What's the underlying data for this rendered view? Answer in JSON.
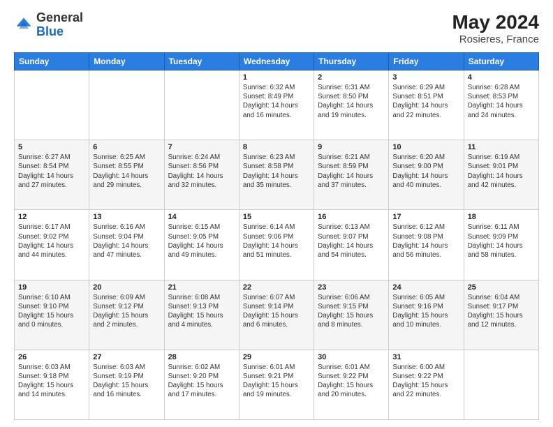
{
  "header": {
    "logo_general": "General",
    "logo_blue": "Blue",
    "month_year": "May 2024",
    "location": "Rosieres, France"
  },
  "weekdays": [
    "Sunday",
    "Monday",
    "Tuesday",
    "Wednesday",
    "Thursday",
    "Friday",
    "Saturday"
  ],
  "weeks": [
    [
      {
        "day": "",
        "info": ""
      },
      {
        "day": "",
        "info": ""
      },
      {
        "day": "",
        "info": ""
      },
      {
        "day": "1",
        "info": "Sunrise: 6:32 AM\nSunset: 8:49 PM\nDaylight: 14 hours\nand 16 minutes."
      },
      {
        "day": "2",
        "info": "Sunrise: 6:31 AM\nSunset: 8:50 PM\nDaylight: 14 hours\nand 19 minutes."
      },
      {
        "day": "3",
        "info": "Sunrise: 6:29 AM\nSunset: 8:51 PM\nDaylight: 14 hours\nand 22 minutes."
      },
      {
        "day": "4",
        "info": "Sunrise: 6:28 AM\nSunset: 8:53 PM\nDaylight: 14 hours\nand 24 minutes."
      }
    ],
    [
      {
        "day": "5",
        "info": "Sunrise: 6:27 AM\nSunset: 8:54 PM\nDaylight: 14 hours\nand 27 minutes."
      },
      {
        "day": "6",
        "info": "Sunrise: 6:25 AM\nSunset: 8:55 PM\nDaylight: 14 hours\nand 29 minutes."
      },
      {
        "day": "7",
        "info": "Sunrise: 6:24 AM\nSunset: 8:56 PM\nDaylight: 14 hours\nand 32 minutes."
      },
      {
        "day": "8",
        "info": "Sunrise: 6:23 AM\nSunset: 8:58 PM\nDaylight: 14 hours\nand 35 minutes."
      },
      {
        "day": "9",
        "info": "Sunrise: 6:21 AM\nSunset: 8:59 PM\nDaylight: 14 hours\nand 37 minutes."
      },
      {
        "day": "10",
        "info": "Sunrise: 6:20 AM\nSunset: 9:00 PM\nDaylight: 14 hours\nand 40 minutes."
      },
      {
        "day": "11",
        "info": "Sunrise: 6:19 AM\nSunset: 9:01 PM\nDaylight: 14 hours\nand 42 minutes."
      }
    ],
    [
      {
        "day": "12",
        "info": "Sunrise: 6:17 AM\nSunset: 9:02 PM\nDaylight: 14 hours\nand 44 minutes."
      },
      {
        "day": "13",
        "info": "Sunrise: 6:16 AM\nSunset: 9:04 PM\nDaylight: 14 hours\nand 47 minutes."
      },
      {
        "day": "14",
        "info": "Sunrise: 6:15 AM\nSunset: 9:05 PM\nDaylight: 14 hours\nand 49 minutes."
      },
      {
        "day": "15",
        "info": "Sunrise: 6:14 AM\nSunset: 9:06 PM\nDaylight: 14 hours\nand 51 minutes."
      },
      {
        "day": "16",
        "info": "Sunrise: 6:13 AM\nSunset: 9:07 PM\nDaylight: 14 hours\nand 54 minutes."
      },
      {
        "day": "17",
        "info": "Sunrise: 6:12 AM\nSunset: 9:08 PM\nDaylight: 14 hours\nand 56 minutes."
      },
      {
        "day": "18",
        "info": "Sunrise: 6:11 AM\nSunset: 9:09 PM\nDaylight: 14 hours\nand 58 minutes."
      }
    ],
    [
      {
        "day": "19",
        "info": "Sunrise: 6:10 AM\nSunset: 9:10 PM\nDaylight: 15 hours\nand 0 minutes."
      },
      {
        "day": "20",
        "info": "Sunrise: 6:09 AM\nSunset: 9:12 PM\nDaylight: 15 hours\nand 2 minutes."
      },
      {
        "day": "21",
        "info": "Sunrise: 6:08 AM\nSunset: 9:13 PM\nDaylight: 15 hours\nand 4 minutes."
      },
      {
        "day": "22",
        "info": "Sunrise: 6:07 AM\nSunset: 9:14 PM\nDaylight: 15 hours\nand 6 minutes."
      },
      {
        "day": "23",
        "info": "Sunrise: 6:06 AM\nSunset: 9:15 PM\nDaylight: 15 hours\nand 8 minutes."
      },
      {
        "day": "24",
        "info": "Sunrise: 6:05 AM\nSunset: 9:16 PM\nDaylight: 15 hours\nand 10 minutes."
      },
      {
        "day": "25",
        "info": "Sunrise: 6:04 AM\nSunset: 9:17 PM\nDaylight: 15 hours\nand 12 minutes."
      }
    ],
    [
      {
        "day": "26",
        "info": "Sunrise: 6:03 AM\nSunset: 9:18 PM\nDaylight: 15 hours\nand 14 minutes."
      },
      {
        "day": "27",
        "info": "Sunrise: 6:03 AM\nSunset: 9:19 PM\nDaylight: 15 hours\nand 16 minutes."
      },
      {
        "day": "28",
        "info": "Sunrise: 6:02 AM\nSunset: 9:20 PM\nDaylight: 15 hours\nand 17 minutes."
      },
      {
        "day": "29",
        "info": "Sunrise: 6:01 AM\nSunset: 9:21 PM\nDaylight: 15 hours\nand 19 minutes."
      },
      {
        "day": "30",
        "info": "Sunrise: 6:01 AM\nSunset: 9:22 PM\nDaylight: 15 hours\nand 20 minutes."
      },
      {
        "day": "31",
        "info": "Sunrise: 6:00 AM\nSunset: 9:22 PM\nDaylight: 15 hours\nand 22 minutes."
      },
      {
        "day": "",
        "info": ""
      }
    ]
  ]
}
